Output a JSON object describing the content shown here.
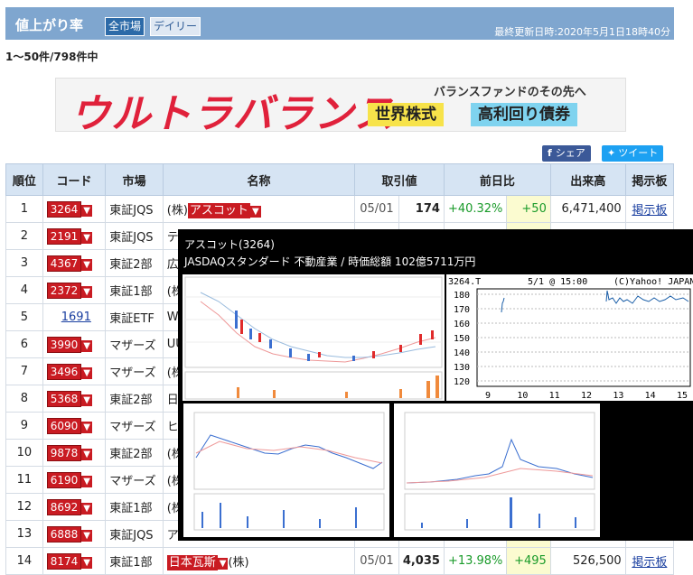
{
  "header": {
    "title": "値上がり率",
    "tab_all_markets": "全市場",
    "tab_daily": "デイリー",
    "updated": "最終更新日時:2020年5月1日18時40分"
  },
  "result_count": "1〜50件/798件中",
  "banner": {
    "brand": "ウルトラバランス",
    "tagline": "バランスファンドのその先へ",
    "pill1": "世界株式",
    "pill2": "高利回り債券"
  },
  "share": {
    "facebook": "シェア",
    "twitter": "ツイート"
  },
  "table": {
    "headers": [
      "順位",
      "コード",
      "市場",
      "名称",
      "取引値",
      "前日比",
      "出来高",
      "掲示板"
    ],
    "rows": [
      {
        "rank": "1",
        "code": "3264",
        "market": "東証JQS",
        "name": "(株)アスコット",
        "date": "05/01",
        "price": "174",
        "pct": "+40.32%",
        "change": "+50",
        "volume": "6,471,400",
        "bbs": "掲示板"
      },
      {
        "rank": "2",
        "code": "2191",
        "market": "東証JQS",
        "name": "テラ",
        "date": "",
        "price": "",
        "pct": "",
        "change": "",
        "volume": "",
        "bbs": ""
      },
      {
        "rank": "3",
        "code": "4367",
        "market": "東証2部",
        "name": "広栄",
        "date": "",
        "price": "",
        "pct": "",
        "change": "",
        "volume": "",
        "bbs": ""
      },
      {
        "rank": "4",
        "code": "2372",
        "market": "東証1部",
        "name": "(株)",
        "date": "",
        "price": "",
        "pct": "",
        "change": "",
        "volume": "",
        "bbs": ""
      },
      {
        "rank": "5",
        "code": "1691",
        "market": "東証ETF",
        "name": "Wisd",
        "date": "",
        "price": "",
        "pct": "",
        "change": "",
        "volume": "",
        "bbs": ""
      },
      {
        "rank": "6",
        "code": "3990",
        "market": "マザーズ",
        "name": "UU",
        "date": "",
        "price": "",
        "pct": "",
        "change": "",
        "volume": "",
        "bbs": ""
      },
      {
        "rank": "7",
        "code": "3496",
        "market": "マザーズ",
        "name": "(株)",
        "date": "",
        "price": "",
        "pct": "",
        "change": "",
        "volume": "",
        "bbs": ""
      },
      {
        "rank": "8",
        "code": "5368",
        "market": "東証2部",
        "name": "日本",
        "date": "",
        "price": "",
        "pct": "",
        "change": "",
        "volume": "",
        "bbs": ""
      },
      {
        "rank": "9",
        "code": "6090",
        "market": "マザーズ",
        "name": "ヒュ",
        "date": "",
        "price": "",
        "pct": "",
        "change": "",
        "volume": "",
        "bbs": ""
      },
      {
        "rank": "10",
        "code": "9878",
        "market": "東証2部",
        "name": "(株)",
        "date": "",
        "price": "",
        "pct": "",
        "change": "",
        "volume": "",
        "bbs": ""
      },
      {
        "rank": "11",
        "code": "6190",
        "market": "マザーズ",
        "name": "(株)",
        "date": "",
        "price": "",
        "pct": "",
        "change": "",
        "volume": "",
        "bbs": ""
      },
      {
        "rank": "12",
        "code": "8692",
        "market": "東証1部",
        "name": "(株)",
        "date": "",
        "price": "",
        "pct": "",
        "change": "",
        "volume": "",
        "bbs": ""
      },
      {
        "rank": "13",
        "code": "6888",
        "market": "東証JQS",
        "name": "アク",
        "date": "",
        "price": "",
        "pct": "",
        "change": "",
        "volume": "",
        "bbs": ""
      },
      {
        "rank": "14",
        "code": "8174",
        "market": "東証1部",
        "name": "日本瓦斯(株)",
        "date": "05/01",
        "price": "4,035",
        "pct": "+13.98%",
        "change": "+495",
        "volume": "526,500",
        "bbs": "掲示板"
      }
    ]
  },
  "popup": {
    "title": "アスコット(3264)",
    "subtitle": "JASDAQスタンダード 不動産業 / 時価総額 102億5711万円",
    "intraday": {
      "symbol": "3264.T",
      "timestamp": "5/1 @ 15:00",
      "copyright": "(C)Yahoo! JAPAN",
      "y_ticks": [
        "180",
        "170",
        "160",
        "150",
        "140",
        "130",
        "120"
      ],
      "x_ticks": [
        "9",
        "10",
        "11",
        "12",
        "13",
        "14",
        "15"
      ]
    }
  },
  "colors": {
    "header_bg": "#7fa6cf",
    "code_red": "#c91b22",
    "up_green": "#1a9b2a"
  }
}
